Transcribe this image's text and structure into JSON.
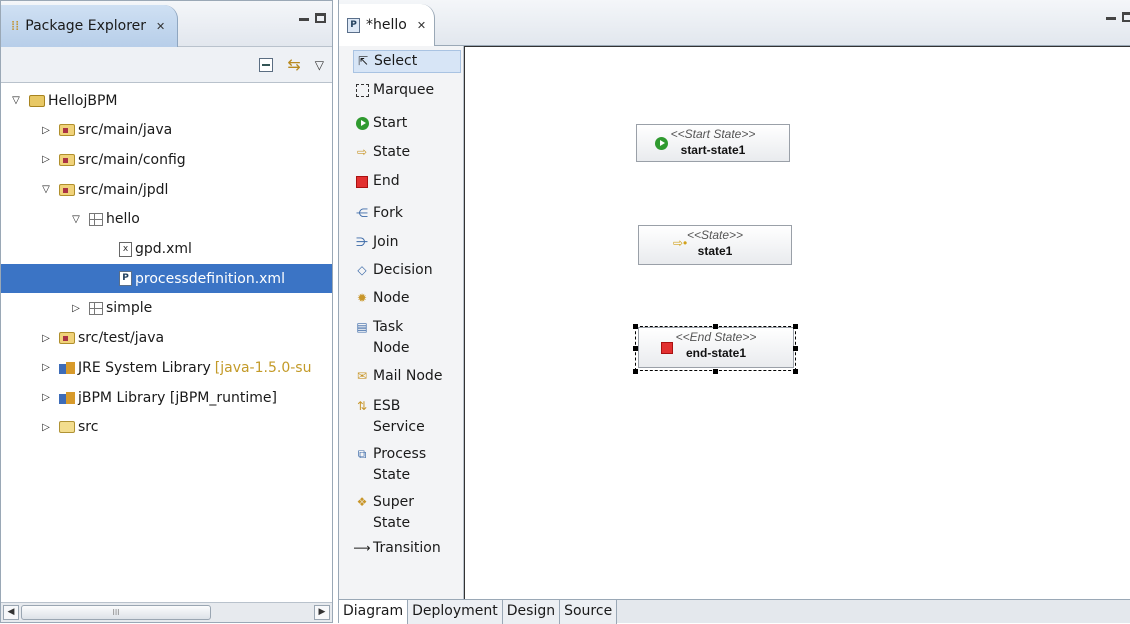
{
  "explorer": {
    "title": "Package Explorer",
    "tree": [
      {
        "label": "HellojBPM",
        "icon": "project-icon",
        "twisty": "expanded",
        "indent": 0
      },
      {
        "label": "src/main/java",
        "icon": "source-folder-icon",
        "twisty": "collapsed",
        "indent": 1
      },
      {
        "label": "src/main/config",
        "icon": "source-folder-icon",
        "twisty": "collapsed",
        "indent": 1
      },
      {
        "label": "src/main/jpdl",
        "icon": "source-folder-icon",
        "twisty": "expanded",
        "indent": 1
      },
      {
        "label": "hello",
        "icon": "package-icon",
        "twisty": "expanded",
        "indent": 2
      },
      {
        "label": "gpd.xml",
        "icon": "xml-file-icon",
        "twisty": "none",
        "indent": 3
      },
      {
        "label": "processdefinition.xml",
        "icon": "process-definition-icon",
        "twisty": "none",
        "indent": 3,
        "selected": true
      },
      {
        "label": "simple",
        "icon": "package-icon",
        "twisty": "collapsed",
        "indent": 2
      },
      {
        "label": "src/test/java",
        "icon": "source-folder-icon",
        "twisty": "collapsed",
        "indent": 1
      },
      {
        "label": "JRE System Library",
        "suffix": "[java-1.5.0-su",
        "icon": "library-icon",
        "twisty": "collapsed",
        "indent": 1
      },
      {
        "label": "jBPM Library [jBPM_runtime]",
        "icon": "library-icon",
        "twisty": "collapsed",
        "indent": 1
      },
      {
        "label": "src",
        "icon": "folder-icon",
        "twisty": "collapsed",
        "indent": 1
      }
    ],
    "scroll_thumb_label": "III"
  },
  "editor": {
    "tab_label": "*hello",
    "palette": [
      {
        "label": "Select",
        "icon": "select-arrow-icon",
        "selected": true
      },
      {
        "label": "Marquee",
        "icon": "marquee-icon"
      },
      {
        "label": "Start",
        "icon": "start-icon"
      },
      {
        "label": "State",
        "icon": "state-icon"
      },
      {
        "label": "End",
        "icon": "end-icon"
      },
      {
        "label": "Fork",
        "icon": "fork-icon"
      },
      {
        "label": "Join",
        "icon": "join-icon"
      },
      {
        "label": "Decision",
        "icon": "decision-icon"
      },
      {
        "label": "Node",
        "icon": "node-icon"
      },
      {
        "label": "Task",
        "label2": "Node",
        "icon": "task-node-icon"
      },
      {
        "label": "Mail Node",
        "icon": "mail-node-icon"
      },
      {
        "label": "ESB",
        "label2": "Service",
        "icon": "esb-service-icon"
      },
      {
        "label": "Process",
        "label2": "State",
        "icon": "process-state-icon"
      },
      {
        "label": "Super",
        "label2": "State",
        "icon": "super-state-icon"
      },
      {
        "label": "Transition",
        "icon": "transition-icon"
      }
    ],
    "nodes": [
      {
        "stereotype": "<<Start State>>",
        "name": "start-state1",
        "icon": "start-icon"
      },
      {
        "stereotype": "<<State>>",
        "name": "state1",
        "icon": "state-icon"
      },
      {
        "stereotype": "<<End State>>",
        "name": "end-state1",
        "icon": "end-icon",
        "selected": true
      }
    ],
    "bottom_tabs": [
      "Diagram",
      "Deployment",
      "Design",
      "Source"
    ],
    "active_bottom_tab": "Diagram"
  }
}
